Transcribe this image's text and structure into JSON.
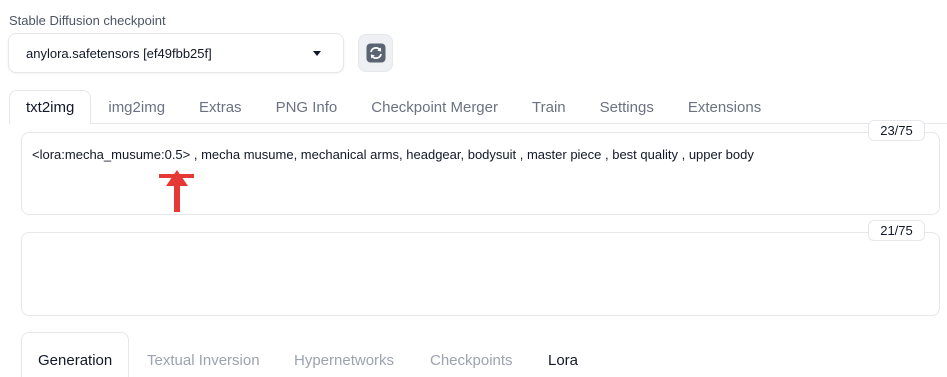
{
  "checkpoint": {
    "label": "Stable Diffusion checkpoint",
    "value": "anylora.safetensors [ef49fbb25f]",
    "dropdown_icon": "chevron-down-icon",
    "refresh_icon": "refresh-icon"
  },
  "tabs": [
    {
      "label": "txt2img",
      "active": true
    },
    {
      "label": "img2img"
    },
    {
      "label": "Extras"
    },
    {
      "label": "PNG Info"
    },
    {
      "label": "Checkpoint Merger"
    },
    {
      "label": "Train"
    },
    {
      "label": "Settings"
    },
    {
      "label": "Extensions"
    }
  ],
  "prompt": {
    "text": "<lora:mecha_musume:0.5> , mecha musume, mechanical arms, headgear, bodysuit , master piece , best quality , upper body",
    "token_count": "23/75"
  },
  "negative_prompt": {
    "text": "",
    "token_count": "21/75"
  },
  "annotation": {
    "color": "#e53935",
    "icon": "up-arrow-icon"
  },
  "subtabs": [
    {
      "label": "Generation",
      "active": true
    },
    {
      "label": "Textual Inversion"
    },
    {
      "label": "Hypernetworks"
    },
    {
      "label": "Checkpoints"
    },
    {
      "label": "Lora"
    }
  ]
}
